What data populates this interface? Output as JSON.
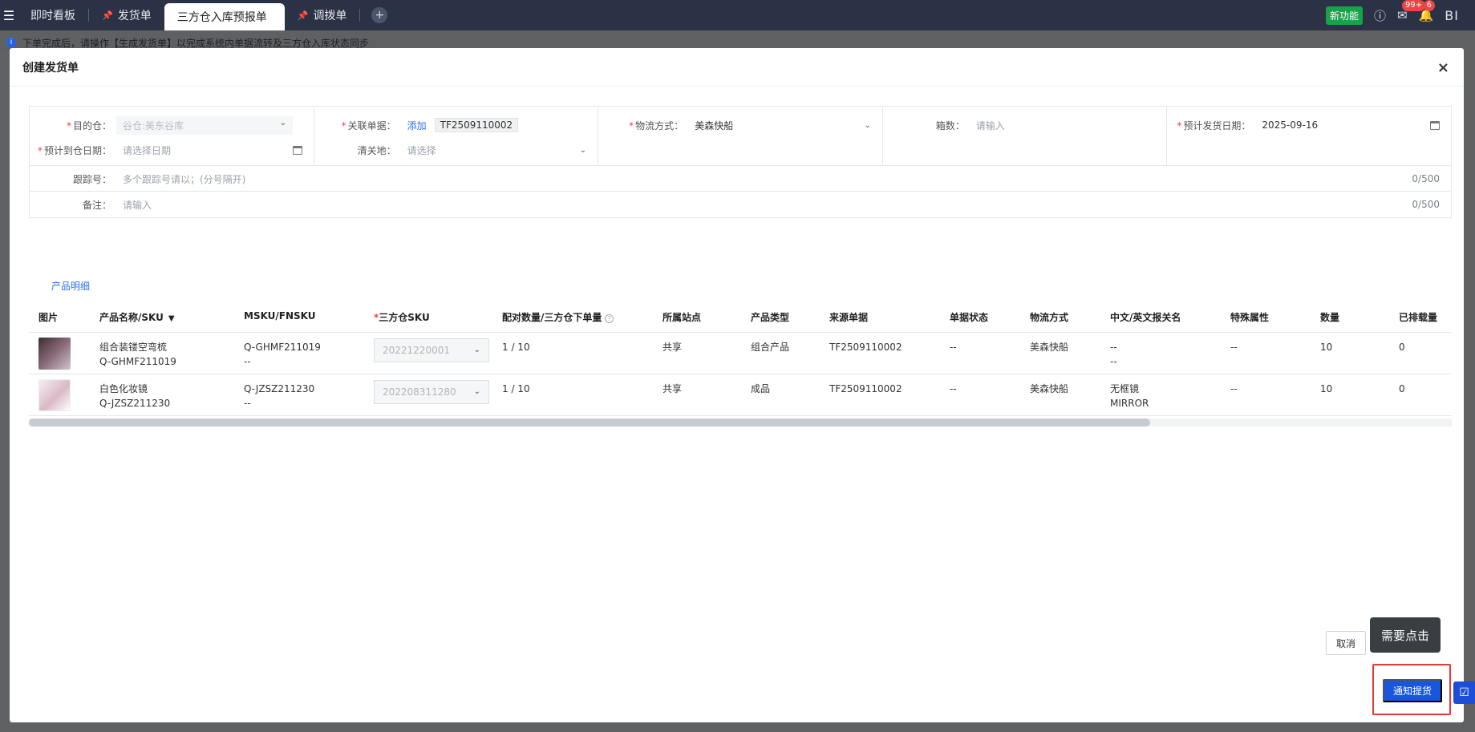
{
  "topbar": {
    "tabs": [
      {
        "label": "即时看板",
        "active": false,
        "pinned": false
      },
      {
        "label": "发货单",
        "active": false,
        "pinned": true
      },
      {
        "label": "三方仓入库预报单",
        "active": true,
        "pinned": false
      },
      {
        "label": "调拨单",
        "active": false,
        "pinned": true
      }
    ],
    "new_feature": "新功能",
    "message_count": "99+",
    "notice_count": "6",
    "bi_label": "BI"
  },
  "notice": "下单完成后，请操作【生成发货单】以完成系统内单据流转及三方仓入库状态同步",
  "dialog": {
    "title": "创建发货单",
    "close": "×",
    "form": {
      "dest_warehouse": {
        "label": "目的仓：",
        "value": "谷仓:美东谷库"
      },
      "related_doc": {
        "label": "关联单据：",
        "add": "添加",
        "tag": "TF2509110002"
      },
      "logistics": {
        "label": "物流方式：",
        "value": "美森快船"
      },
      "box_count": {
        "label": "箱数：",
        "placeholder": "请输入"
      },
      "est_ship_date": {
        "label": "预计发货日期：",
        "value": "2025-09-16"
      },
      "est_arrive_date": {
        "label": "预计到仓日期：",
        "placeholder": "请选择日期"
      },
      "customs": {
        "label": "清关地：",
        "placeholder": "请选择"
      },
      "tracking": {
        "label": "跟踪号：",
        "placeholder": "多个跟踪号请以；(分号隔开)",
        "counter": "0/500"
      },
      "remark": {
        "label": "备注：",
        "placeholder": "请输入",
        "counter": "0/500"
      }
    },
    "section_title": "产品明细",
    "table": {
      "headers": [
        "图片",
        "产品名称/SKU",
        "MSKU/FNSKU",
        "三方仓SKU",
        "配对数量/三方仓下单量",
        "所属站点",
        "产品类型",
        "来源单据",
        "单据状态",
        "物流方式",
        "中文/英文报关名",
        "特殊属性",
        "数量",
        "已排载量"
      ],
      "rows": [
        {
          "name": "组合装镂空弯梳",
          "sku": "Q-GHMF211019",
          "msku": "Q-GHMF211019",
          "fnsku": "--",
          "wh_sku": "20221220001",
          "pair": "1 /  10",
          "site": "共享",
          "type": "组合产品",
          "source": "TF2509110002",
          "status": "--",
          "logistics": "美森快船",
          "cn_name": "--",
          "en_name": "--",
          "special": "--",
          "qty": "10",
          "scheduled": "0"
        },
        {
          "name": "白色化妆镜",
          "sku": "Q-JZSZ211230",
          "msku": "Q-JZSZ211230",
          "fnsku": "--",
          "wh_sku": "202208311280",
          "pair": "1 /  10",
          "site": "共享",
          "type": "成品",
          "source": "TF2509110002",
          "status": "--",
          "logistics": "美森快船",
          "cn_name": "无框镜",
          "en_name": "MIRROR",
          "special": "--",
          "qty": "10",
          "scheduled": "0"
        }
      ]
    },
    "buttons": {
      "cancel": "取消",
      "notify": "通知提货"
    },
    "tooltip": "需要点击"
  },
  "colors": {
    "primary": "#1a56db",
    "highlight": "#e53935",
    "topbar": "#2b3245"
  }
}
